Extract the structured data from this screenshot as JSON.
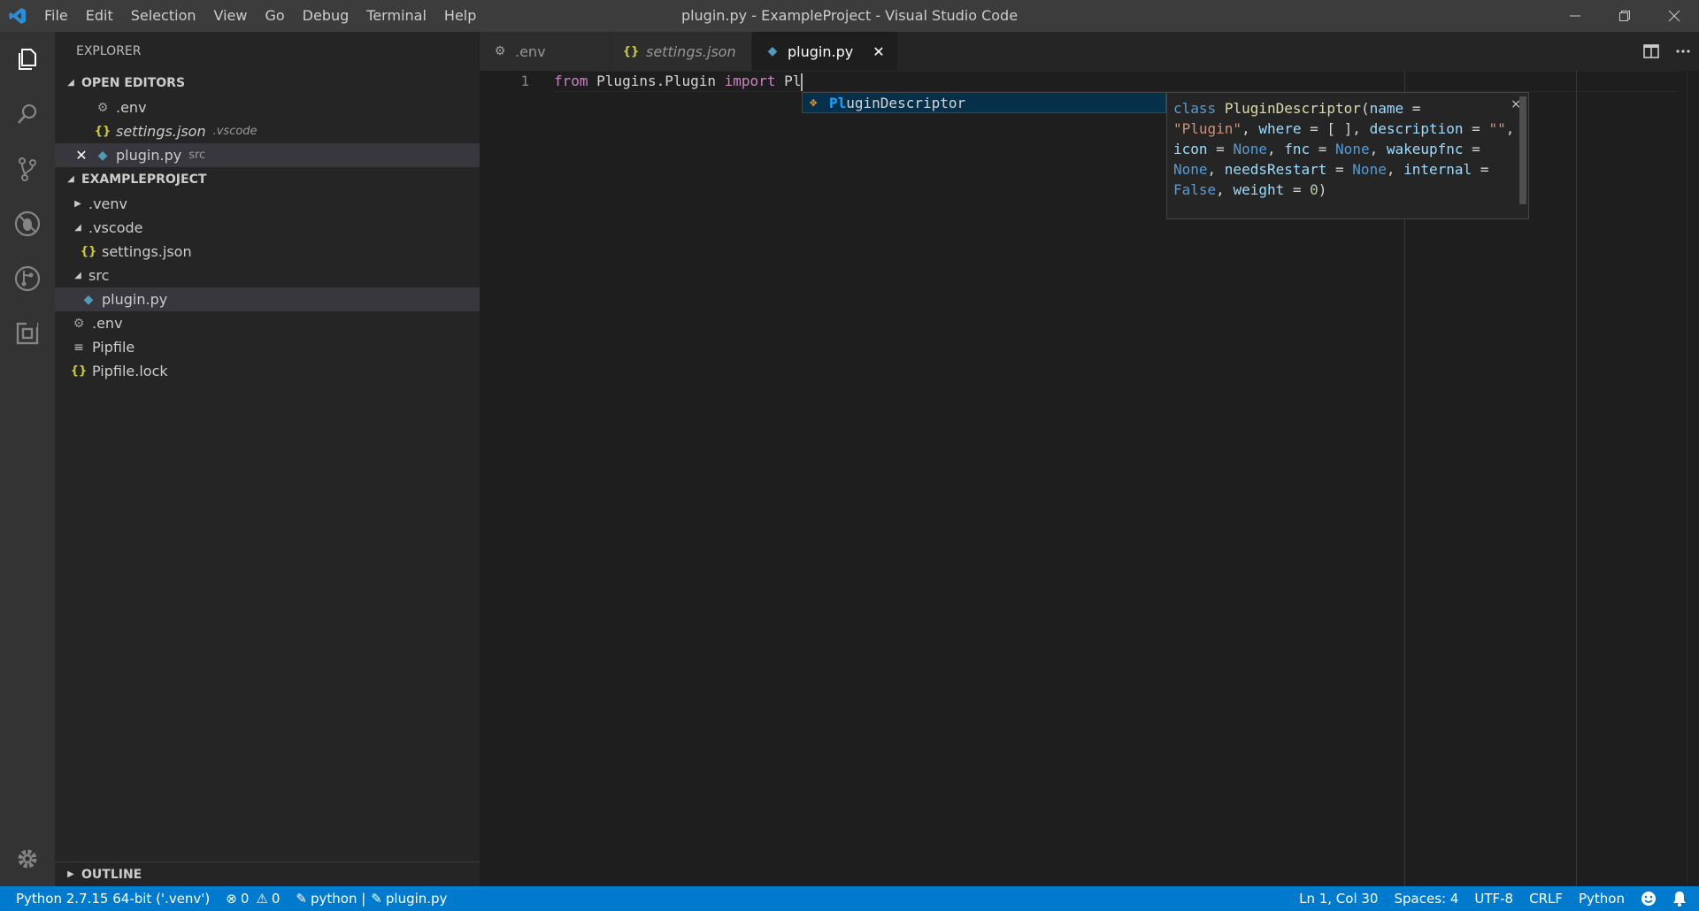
{
  "titlebar": {
    "menu": [
      "File",
      "Edit",
      "Selection",
      "View",
      "Go",
      "Debug",
      "Terminal",
      "Help"
    ],
    "title": "plugin.py - ExampleProject - Visual Studio Code"
  },
  "sidebar": {
    "title": "EXPLORER",
    "open_editors": {
      "header": "OPEN EDITORS",
      "items": [
        {
          "name": ".env",
          "desc": ""
        },
        {
          "name": "settings.json",
          "desc": ".vscode"
        },
        {
          "name": "plugin.py",
          "desc": "src"
        }
      ]
    },
    "project": {
      "header": "EXAMPLEPROJECT",
      "items": [
        {
          "name": ".venv"
        },
        {
          "name": ".vscode"
        },
        {
          "name": "settings.json"
        },
        {
          "name": "src"
        },
        {
          "name": "plugin.py"
        },
        {
          "name": ".env"
        },
        {
          "name": "Pipfile"
        },
        {
          "name": "Pipfile.lock"
        }
      ]
    },
    "outline": "OUTLINE"
  },
  "tabs": [
    {
      "label": ".env"
    },
    {
      "label": "settings.json"
    },
    {
      "label": "plugin.py"
    }
  ],
  "editor": {
    "line_number": "1",
    "code": {
      "kw1": "from",
      "mod": " Plugins.Plugin ",
      "kw2": "import",
      "typed": " Pl"
    }
  },
  "suggest": {
    "match": "Pl",
    "rest": "uginDescriptor"
  },
  "details": {
    "close": "×",
    "l1": {
      "a": "class",
      "b": " ",
      "c": "PluginDescriptor",
      "d": "(",
      "e": "name",
      "f": " ="
    },
    "l2": {
      "a": "\"Plugin\"",
      "b": ", ",
      "c": "where",
      "d": " = [ ], ",
      "e": "description",
      "f": " = ",
      "g": "\"\"",
      "h": ","
    },
    "l3": {
      "a": "icon",
      "b": " = ",
      "c": "None",
      "d": ", ",
      "e": "fnc",
      "f": " = ",
      "g": "None",
      "h": ", ",
      "i": "wakeupfnc",
      "j": " ="
    },
    "l4": {
      "a": "None",
      "b": ", ",
      "c": "needsRestart",
      "d": " = ",
      "e": "None",
      "f": ", ",
      "g": "internal",
      "h": " ="
    },
    "l5": {
      "a": "False",
      "b": ", ",
      "c": "weight",
      "d": " = ",
      "e": "0",
      "f": ")"
    }
  },
  "statusbar": {
    "interpreter": "Python 2.7.15 64-bit ('.venv')",
    "errors": "0",
    "warnings": "0",
    "env": "python |",
    "file": "plugin.py",
    "position": "Ln 1, Col 30",
    "spaces": "Spaces: 4",
    "encoding": "UTF-8",
    "eol": "CRLF",
    "language": "Python"
  }
}
